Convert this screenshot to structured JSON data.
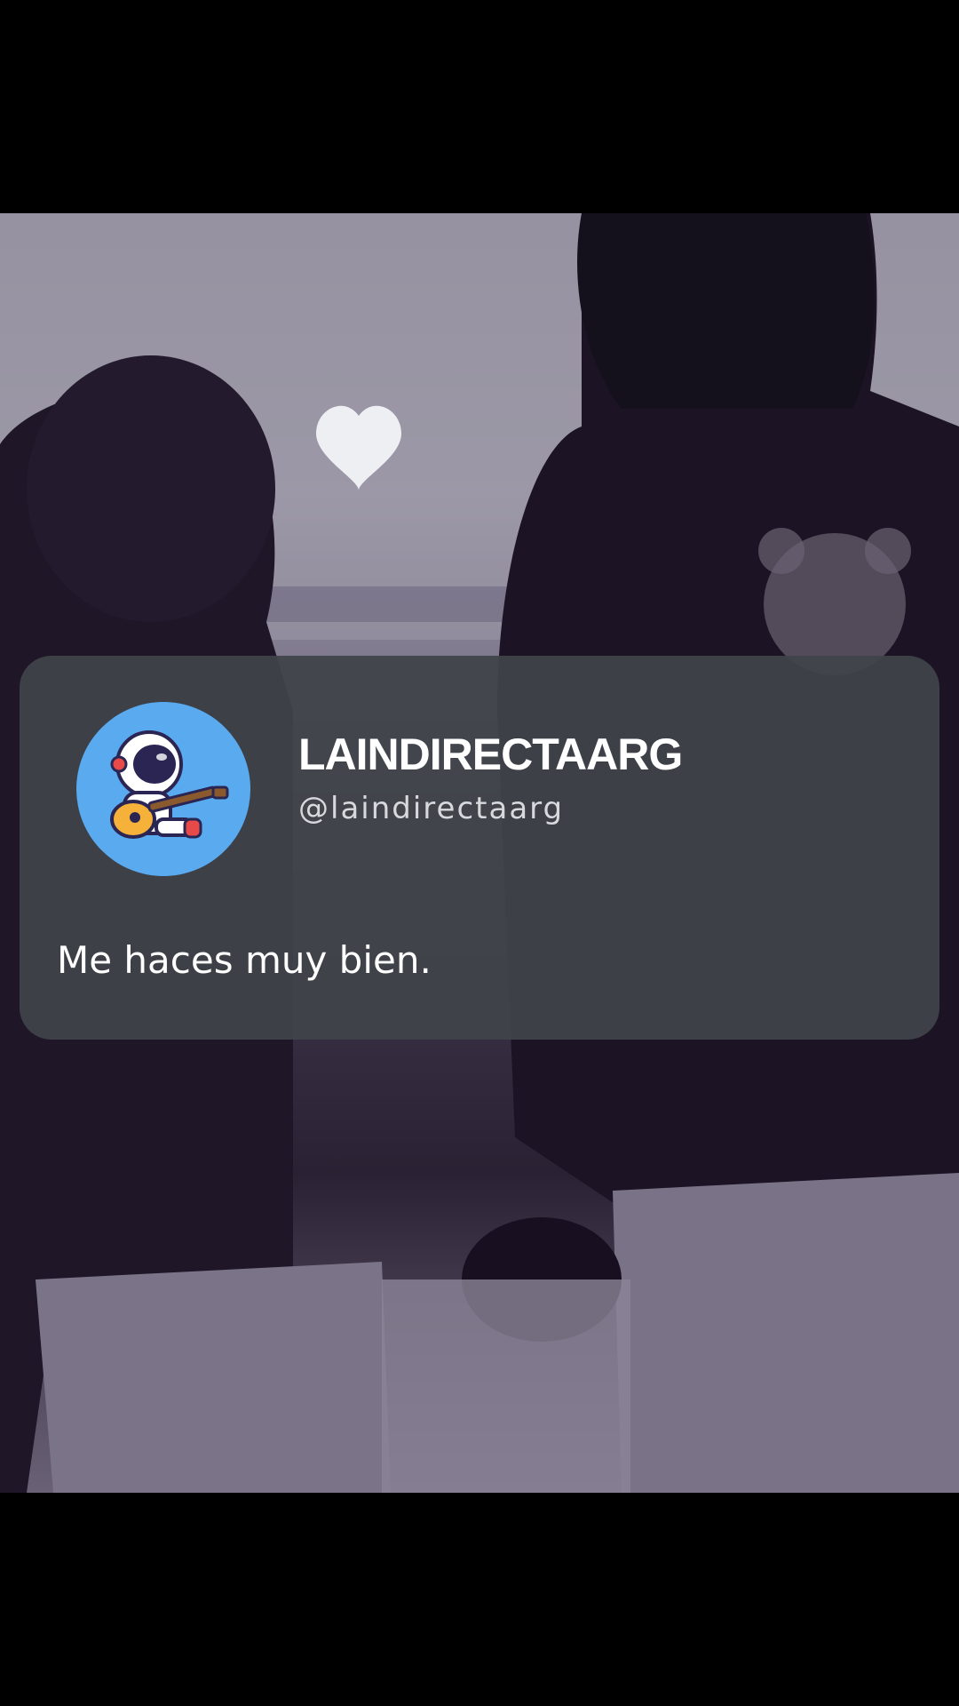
{
  "post": {
    "display_name": "LAINDIRECTAARG",
    "handle": "@laindirectaarg",
    "message": "Me haces muy bien.",
    "avatar_icon": "astronaut-guitar-icon"
  },
  "colors": {
    "card_background": "#404449",
    "avatar_background": "#5aaaf0",
    "text_primary": "#ffffff",
    "text_secondary": "#d7d9dc"
  }
}
